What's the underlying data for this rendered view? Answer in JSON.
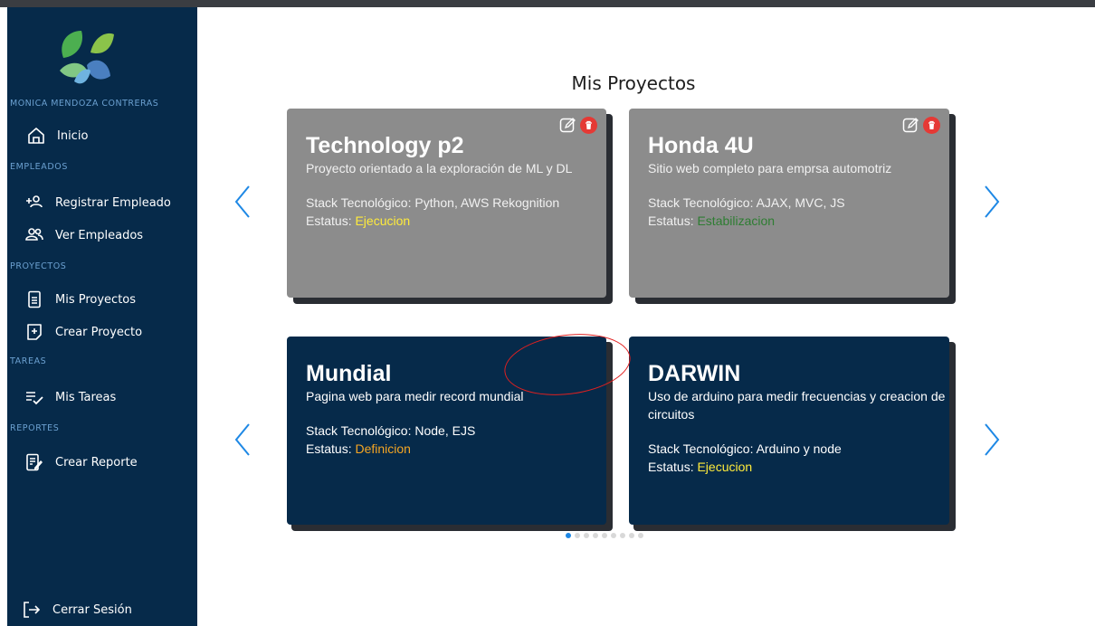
{
  "user": {
    "name": "MONICA MENDOZA CONTRERAS"
  },
  "sidebar": {
    "inicio": "Inicio",
    "sections": {
      "empleados": "EMPLEADOS",
      "proyectos": "PROYECTOS",
      "tareas": "TAREAS",
      "reportes": "REPORTES"
    },
    "items": {
      "registrar_empleado": "Registrar Empleado",
      "ver_empleados": "Ver Empleados",
      "mis_proyectos": "Mis Proyectos",
      "crear_proyecto": "Crear Proyecto",
      "mis_tareas": "Mis Tareas",
      "crear_reporte": "Crear Reporte"
    },
    "logout": "Cerrar Sesión"
  },
  "page": {
    "title": "Mis Proyectos"
  },
  "projects": [
    {
      "title": "Technology p2",
      "description": "Proyecto orientado a la exploración de ML y DL",
      "stack": "Stack Tecnológico: Python, AWS Rekognition",
      "status_label": "Estatus: ",
      "status": "Ejecucion",
      "status_color": "#ffeb3b",
      "card_color": "gray"
    },
    {
      "title": "Honda 4U",
      "description": "Sitio web completo para emprsa automotriz",
      "stack": "Stack Tecnológico: AJAX, MVC, JS",
      "status_label": "Estatus: ",
      "status": "Estabilizacion",
      "status_color": "#2e7d32",
      "card_color": "gray"
    },
    {
      "title": "Mundial",
      "description": "Pagina web para medir record mundial",
      "stack": "Stack Tecnológico: Node, EJS",
      "status_label": "Estatus: ",
      "status": "Definicion",
      "status_color": "#f5a623",
      "card_color": "navy"
    },
    {
      "title": "DARWIN",
      "description": "Uso de arduino para medir frecuencias y creacion de circuitos",
      "stack": "Stack Tecnológico: Arduino y node",
      "status_label": "Estatus: ",
      "status": "Ejecucion",
      "status_color": "#ffeb3b",
      "card_color": "navy"
    }
  ],
  "carousel": {
    "total_pages": 9,
    "active_page": 1
  },
  "colors": {
    "sidebar": "#062a4a",
    "accent": "#1e88e5",
    "card_gray": "#8c8c8c",
    "delete": "#e53935"
  },
  "icons": [
    "logo-leaves-icon",
    "home-icon",
    "add-user-icon",
    "users-icon",
    "document-icon",
    "add-document-icon",
    "tasks-icon",
    "report-edit-icon",
    "logout-icon",
    "edit-icon",
    "trash-icon",
    "chevron-left-icon",
    "chevron-right-icon"
  ]
}
